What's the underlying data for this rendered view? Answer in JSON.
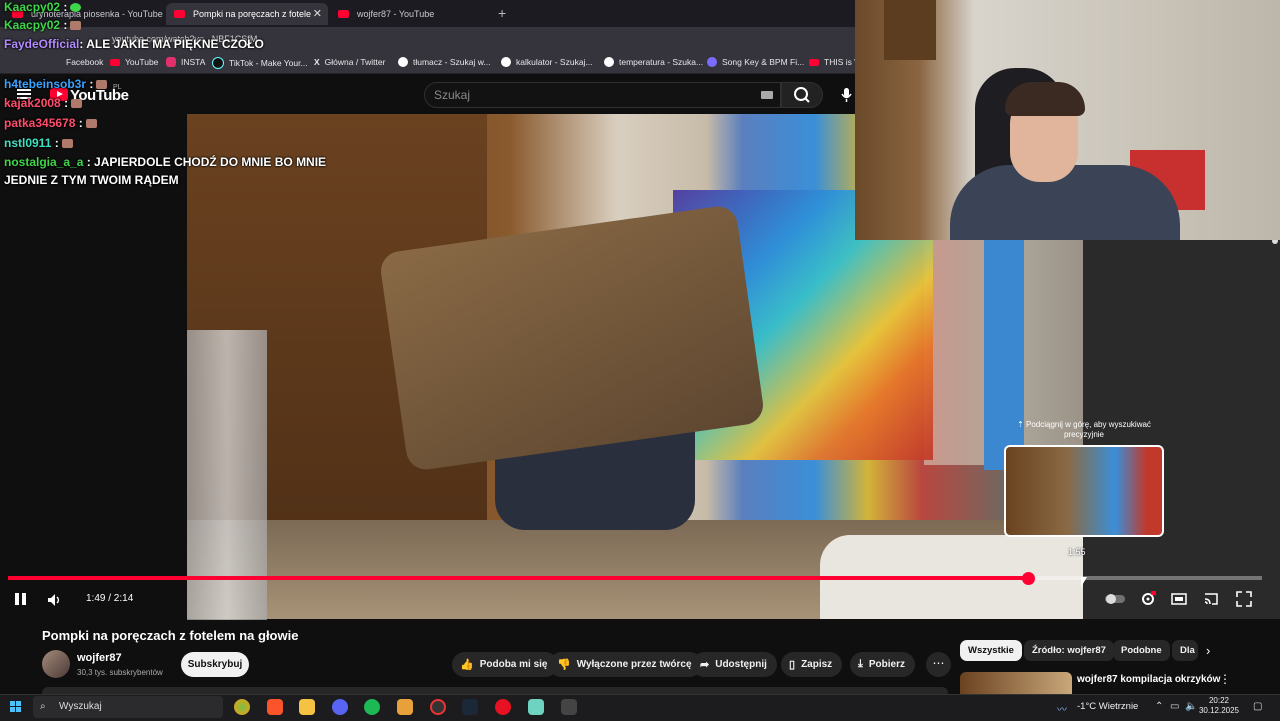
{
  "browser": {
    "tabs": [
      {
        "label": "urynoterapia piosenka - YouTube",
        "active": false
      },
      {
        "label": "Pompki na poręczach z fotele",
        "active": true
      },
      {
        "label": "wojfer87 - YouTube",
        "active": false
      }
    ],
    "url": "youtube.com/watch?v=...NBF1CSfM",
    "bookmarks": [
      {
        "label": "Facebook",
        "icon": "facebook-icon"
      },
      {
        "label": "YouTube",
        "icon": "youtube-icon"
      },
      {
        "label": "INSTA",
        "icon": "instagram-icon"
      },
      {
        "label": "TikTok - Make Your...",
        "icon": "tiktok-icon"
      },
      {
        "label": "Główna / Twitter",
        "icon": "x-icon"
      },
      {
        "label": "tłumacz - Szukaj w...",
        "icon": "google-icon"
      },
      {
        "label": "kalkulator - Szukaj...",
        "icon": "google-icon"
      },
      {
        "label": "temperatura - Szuka...",
        "icon": "google-icon"
      },
      {
        "label": "Song Key & BPM Fi...",
        "icon": "music-icon"
      },
      {
        "label": "THIS is W",
        "icon": "youtube-icon"
      }
    ]
  },
  "youtube": {
    "logo_text": "YouTube",
    "region": "PL",
    "search_placeholder": "Szukaj"
  },
  "chat": [
    {
      "user": "Kaacpy02",
      "color": "#3fd64a",
      "text": ":"
    },
    {
      "user": "Kaacpy02",
      "color": "#3fd64a",
      "text": ":"
    },
    {
      "user": "FaydeOfficial",
      "color": "#b58cff",
      "text": ": ALE JAKIE MA PIĘKNE CZOŁO"
    },
    {
      "user": "h4tebeinsob3r",
      "color": "#3aa2ff",
      "text": ":"
    },
    {
      "user": "kajak2008",
      "color": "#ff4d6d",
      "text": ":"
    },
    {
      "user": "patka345678",
      "color": "#ff4d6d",
      "text": ":"
    },
    {
      "user": "nstl0911",
      "color": "#3fe0c0",
      "text": ":"
    },
    {
      "user": "nostalgia_a_a",
      "color": "#3fd64a",
      "text": ": JAPIERDOLE CHODŹ DO MNIE BO MNIE"
    },
    {
      "user": "",
      "color": "#ffffff",
      "text": "JEDNIE Z TYM TWOIM RĄDEM"
    }
  ],
  "player": {
    "current_time": "1:49 / 2:14",
    "progress_fraction": 0.813,
    "hover_time": "1:55",
    "hover_hint": "⇡ Podciągnij w górę, aby wyszukiwać precyzyjnie",
    "accent": "#ff0033"
  },
  "video": {
    "title": "Pompki na poręczach z fotelem na głowie",
    "channel": "wojfer87",
    "subscribers": "30,3 tys. subskrybentów",
    "subscribe_label": "Subskrybuj",
    "actions": [
      {
        "label": "Podoba mi się",
        "icon": "thumbs-up-icon"
      },
      {
        "label": "Wyłączone przez twórcę",
        "icon": "thumbs-down-icon"
      },
      {
        "label": "Udostępnij",
        "icon": "share-icon"
      },
      {
        "label": "Zapisz",
        "icon": "bookmark-icon"
      },
      {
        "label": "Pobierz",
        "icon": "download-icon"
      }
    ]
  },
  "sidebar": {
    "chips": [
      "Wszystkie",
      "Źródło: wojfer87",
      "Podobne",
      "Dla"
    ],
    "recommendation_title": "wojfer87 kompilacja okrzyków"
  },
  "taskbar": {
    "search_placeholder": "Wyszukaj",
    "weather": "-1°C  Wietrznie",
    "time": "20:22",
    "date": "30.12.2025"
  }
}
